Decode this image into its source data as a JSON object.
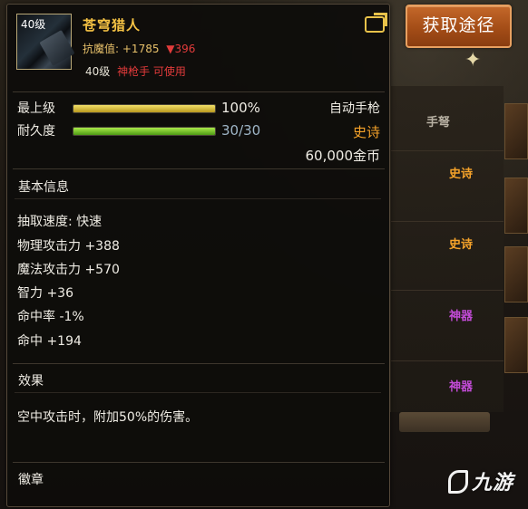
{
  "action_button": {
    "label": "获取途径"
  },
  "item": {
    "name": "苍穹猎人",
    "icon_level": "40级",
    "resist_label": "抗魔值:",
    "resist_value": "+1785",
    "resist_delta": "▼396",
    "req_level": "40级",
    "req_class": "神枪手 可使用",
    "quality": "史诗",
    "weapon_type": "自动手枪",
    "price": "60,000金币"
  },
  "bars": {
    "max_level": {
      "label": "最上级",
      "value_text": "100%",
      "fraction": 1.0
    },
    "durability": {
      "label": "耐久度",
      "value_text": "30/30",
      "fraction": 1.0
    }
  },
  "basic_info": {
    "title": "基本信息",
    "attributes": [
      "抽取速度: 快速",
      "物理攻击力 +388",
      "魔法攻击力 +570",
      "智力 +36",
      "命中率 -1%",
      "命中 +194"
    ]
  },
  "effect": {
    "title": "效果",
    "text": "空中攻击时，附加50%的伤害。"
  },
  "emblem": {
    "title": "徽章"
  },
  "background": {
    "tags": [
      "手弩",
      "史诗",
      "史诗",
      "神器",
      "神器"
    ]
  },
  "watermark": "九游",
  "colors": {
    "epic": "#f6a32a",
    "legendary_name": "#f6c344",
    "artifact": "#c24bd6",
    "warning": "#e23b3b",
    "accent_button": "#b4561d"
  },
  "icons": {
    "share": "share-icon"
  }
}
